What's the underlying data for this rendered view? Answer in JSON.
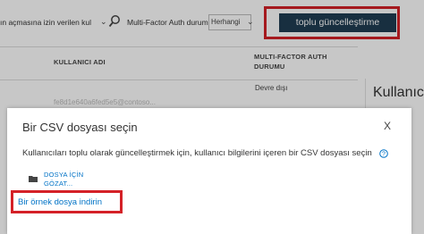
{
  "filter_bar": {
    "view_select_value": "ın açmasına izin verilen kul",
    "mfa_label": "Multi-Factor Auth durumu",
    "mfa_select_value": "Herhangi",
    "bulk_update_label": "toplu güncelleştirme"
  },
  "table": {
    "headers": {
      "username": "KULLANICI ADI",
      "mfa_status": "MULTI-FACTOR AUTH DURUMU"
    },
    "rows": [
      {
        "username": "",
        "mfa_status": "Devre dışı"
      },
      {
        "username": "fe8d1e640a6fed5e5@contoso...",
        "mfa_status": ""
      }
    ]
  },
  "right_panel": {
    "title": "Kullanıcı"
  },
  "dialog": {
    "title": "Bir CSV dosyası seçin",
    "description": "Kullanıcıları toplu olarak güncelleştirmek için, kullanıcı bilgilerini içeren bir CSV dosyası seçin",
    "browse_label": "DOSYA İÇİN GÖZAT...",
    "sample_link": "Bir örnek dosya indirin",
    "close_glyph": "X"
  },
  "colors": {
    "button_bg": "#1f3d52",
    "highlight": "#d42127",
    "link": "#0072c6"
  },
  "icons": [
    "search-icon",
    "chevron-down-icon",
    "info-icon",
    "folder-icon",
    "close-icon"
  ]
}
